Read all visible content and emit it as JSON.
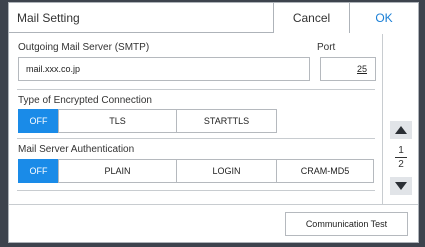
{
  "header": {
    "title": "Mail Setting",
    "cancel_label": "Cancel",
    "ok_label": "OK"
  },
  "smtp": {
    "label": "Outgoing Mail Server (SMTP)",
    "value": "mail.xxx.co.jp",
    "port_label": "Port",
    "port_value": "25"
  },
  "encryption": {
    "label": "Type of Encrypted Connection",
    "options": [
      "OFF",
      "TLS",
      "STARTTLS"
    ],
    "selected": "OFF"
  },
  "auth": {
    "label": "Mail Server Authentication",
    "options": [
      "OFF",
      "PLAIN",
      "LOGIN",
      "CRAM-MD5"
    ],
    "selected": "OFF"
  },
  "pager": {
    "current": "1",
    "total": "2",
    "up_icon": "up-arrow-icon",
    "down_icon": "down-arrow-icon"
  },
  "footer": {
    "communication_test_label": "Communication Test"
  },
  "colors": {
    "accent": "#1a8be8",
    "ok_text": "#1a7fd6",
    "background": "#3d434d"
  }
}
